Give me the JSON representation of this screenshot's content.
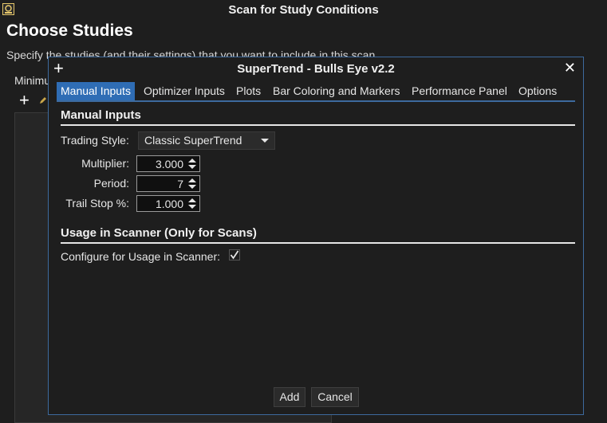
{
  "window": {
    "title": "Scan for Study Conditions",
    "heading": "Choose Studies",
    "description": "Specify the studies (and their settings) that you want to include in this scan",
    "minimum_label": "Minimu"
  },
  "dialog": {
    "title": "SuperTrend - Bulls Eye v2.2",
    "tabs": [
      {
        "label": "Manual Inputs",
        "active": true
      },
      {
        "label": "Optimizer Inputs",
        "active": false
      },
      {
        "label": "Plots",
        "active": false
      },
      {
        "label": "Bar Coloring and Markers",
        "active": false
      },
      {
        "label": "Performance Panel",
        "active": false
      },
      {
        "label": "Options",
        "active": false
      }
    ],
    "manual_inputs": {
      "section_title": "Manual Inputs",
      "trading_style_label": "Trading Style:",
      "trading_style_value": "Classic SuperTrend",
      "multiplier_label": "Multiplier:",
      "multiplier_value": "3.000",
      "period_label": "Period:",
      "period_value": "7",
      "trail_stop_label": "Trail Stop %:",
      "trail_stop_value": "1.000"
    },
    "scanner": {
      "section_title": "Usage in Scanner (Only for Scans)",
      "configure_label": "Configure for Usage in Scanner:",
      "configure_checked": true
    },
    "buttons": {
      "add": "Add",
      "cancel": "Cancel"
    }
  },
  "colors": {
    "accent": "#2f6db5",
    "border": "#3d6a9e",
    "background": "#1e1e1e"
  }
}
